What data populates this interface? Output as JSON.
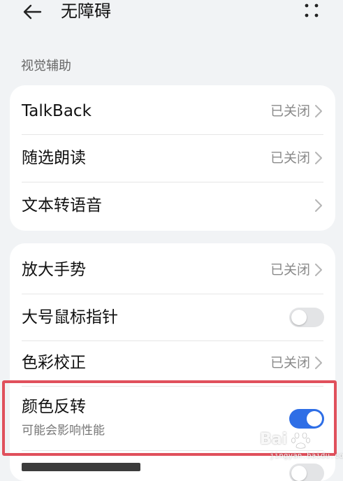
{
  "header": {
    "title": "无障碍"
  },
  "section": {
    "label": "视觉辅助"
  },
  "card1": {
    "items": [
      {
        "title": "TalkBack",
        "value": "已关闭"
      },
      {
        "title": "随选朗读",
        "value": "已关闭"
      },
      {
        "title": "文本转语音"
      }
    ]
  },
  "card2": {
    "items": [
      {
        "title": "放大手势",
        "value": "已关闭"
      },
      {
        "title": "大号鼠标指针",
        "toggle": false
      },
      {
        "title": "色彩校正",
        "value": "已关闭"
      },
      {
        "title": "颜色反转",
        "subtitle": "可能会影响性能",
        "toggle": true
      }
    ]
  },
  "watermark": {
    "text": "Bai",
    "sub": "jingyan.baidu.com"
  },
  "colors": {
    "accent": "#2e6ee6",
    "highlight": "#e0505c",
    "background": "#f1f3f5"
  }
}
